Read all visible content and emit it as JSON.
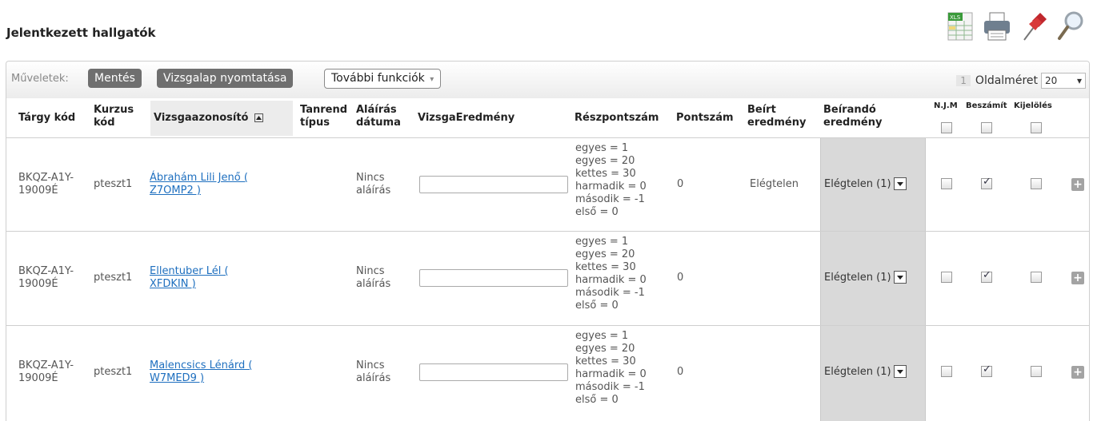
{
  "page": {
    "title": "Jelentkezett hallgatók"
  },
  "top_icons": [
    {
      "name": "xls-export-icon",
      "label": "XLS"
    },
    {
      "name": "print-icon"
    },
    {
      "name": "pin-icon"
    },
    {
      "name": "search-icon"
    }
  ],
  "toolbar": {
    "label": "Műveletek:",
    "save_label": "Mentés",
    "print_label": "Vizsgalap nyomtatása",
    "more_label": "További funkciók",
    "more_arrow": "▾",
    "page_number": "1",
    "page_size_label": "Oldalméret",
    "page_size_value": "20",
    "page_size_arrow": "▾"
  },
  "columns": {
    "targy_kod": "Tárgy kód",
    "kurzus_kod_1": "Kurzus",
    "kurzus_kod_2": "kód",
    "vizsgaazonosito": "Vizsgaazonosító",
    "tanrend_1": "Tanrend",
    "tanrend_2": "típus",
    "alairas_1": "Aláírás",
    "alairas_2": "dátuma",
    "vizsgaeredmeny": "VizsgaEredmény",
    "reszpontszam": "Részpontszám",
    "pontszam": "Pontszám",
    "beirt_1": "Beírt",
    "beirt_2": "eredmény",
    "beirando_1": "Beírandó",
    "beirando_2": "eredmény",
    "njm": "N.J.M",
    "beszamit": "Beszámít",
    "kijeloles": "Kijelölés"
  },
  "rows": [
    {
      "targy_kod_1": "BKQZ-A1Y-",
      "targy_kod_2": "19009É",
      "kurzus_kod": "pteszt1",
      "name_1": "Ábrahám Lili Jenő (",
      "name_2": "Z7OMP2 )",
      "alairas_1": "Nincs",
      "alairas_2": "aláírás",
      "vizsga_input": "",
      "reszpont": [
        "egyes = 1",
        "egyes = 20",
        "kettes = 30",
        "harmadik = 0",
        "második = -1",
        "első = 0"
      ],
      "pontszam": "0",
      "beirt": "Elégtelen",
      "beirando": "Elégtelen (1)",
      "njm": false,
      "beszamit": true,
      "kijeloles": false,
      "plus": "+"
    },
    {
      "targy_kod_1": "BKQZ-A1Y-",
      "targy_kod_2": "19009É",
      "kurzus_kod": "pteszt1",
      "name_1": "Ellentuber Lél (",
      "name_2": "XFDKIN )",
      "alairas_1": "Nincs",
      "alairas_2": "aláírás",
      "vizsga_input": "",
      "reszpont": [
        "egyes = 1",
        "egyes = 20",
        "kettes = 30",
        "harmadik = 0",
        "második = -1",
        "első = 0"
      ],
      "pontszam": "0",
      "beirt": "",
      "beirando": "Elégtelen (1)",
      "njm": false,
      "beszamit": true,
      "kijeloles": false,
      "plus": "+"
    },
    {
      "targy_kod_1": "BKQZ-A1Y-",
      "targy_kod_2": "19009É",
      "kurzus_kod": "pteszt1",
      "name_1": "Malencsics Lénárd (",
      "name_2": "W7MED9 )",
      "alairas_1": "Nincs",
      "alairas_2": "aláírás",
      "vizsga_input": "",
      "reszpont": [
        "egyes = 1",
        "egyes = 20",
        "kettes = 30",
        "harmadik = 0",
        "második = -1",
        "első = 0"
      ],
      "pontszam": "0",
      "beirt": "",
      "beirando": "Elégtelen (1)",
      "njm": false,
      "beszamit": true,
      "kijeloles": false,
      "plus": "+"
    }
  ]
}
